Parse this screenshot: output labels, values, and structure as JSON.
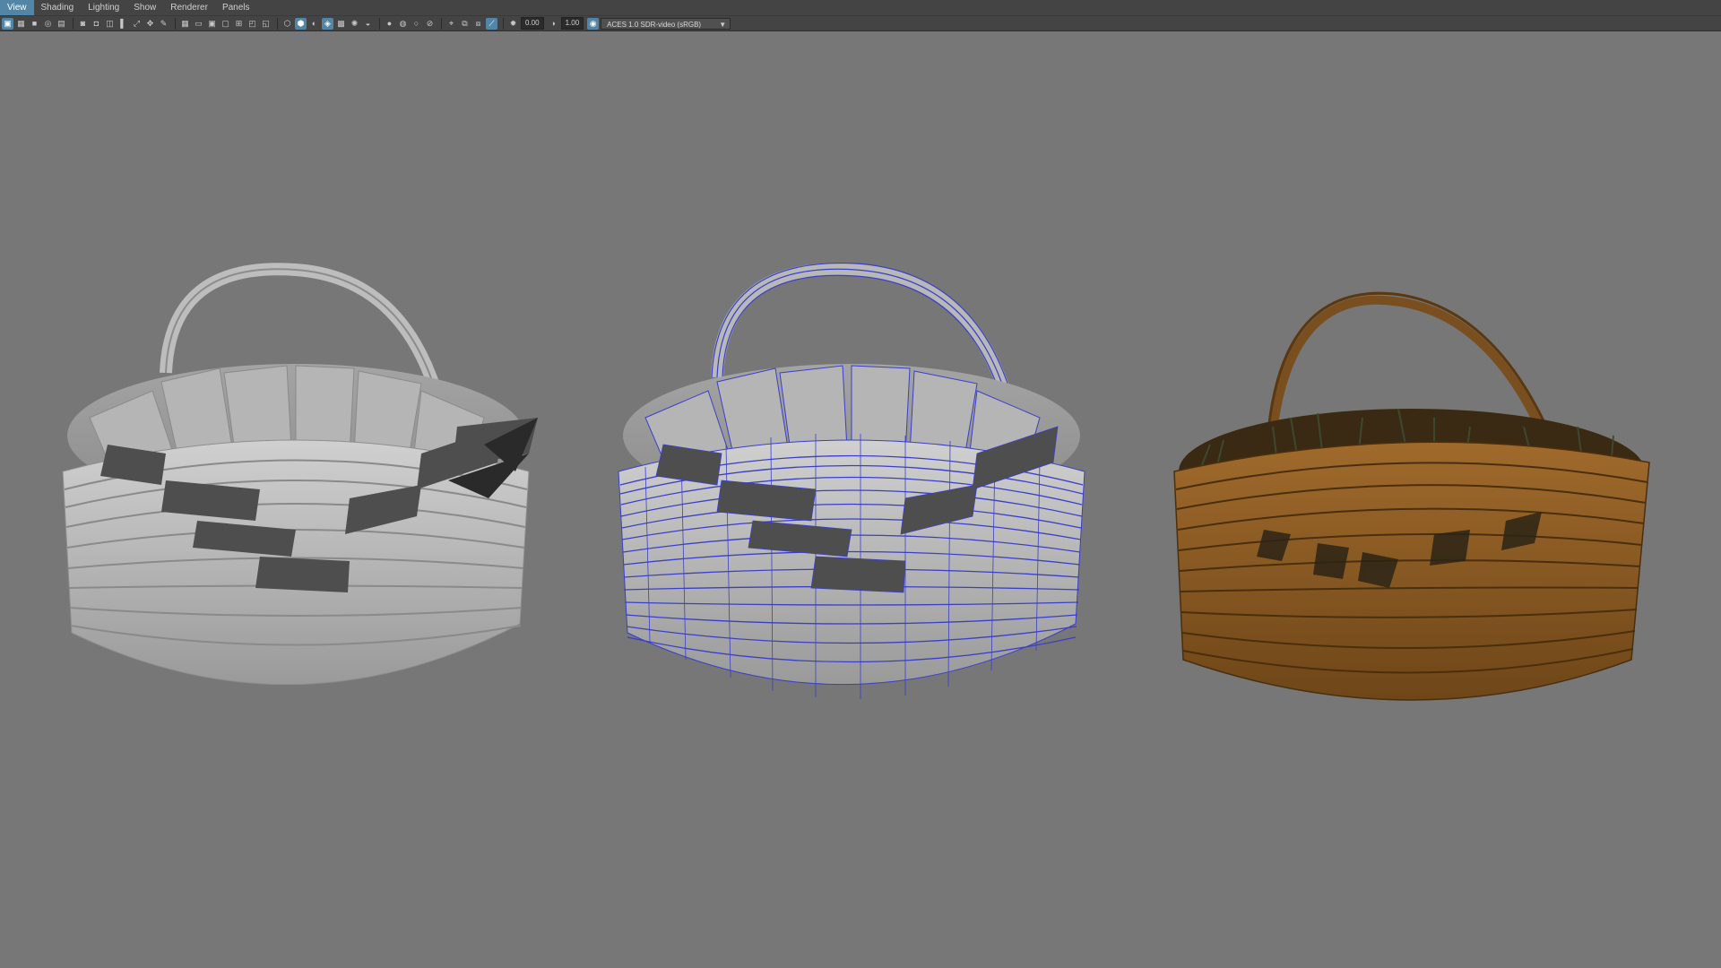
{
  "menu": {
    "view": "View",
    "shading": "Shading",
    "lighting": "Lighting",
    "show": "Show",
    "renderer": "Renderer",
    "panels": "Panels"
  },
  "toolbar": {
    "exposure_value": "0.00",
    "gamma_value": "1.00",
    "color_space": "ACES 1.0 SDR-video (sRGB)"
  },
  "viewport": {
    "background_color": "#777777",
    "models": [
      {
        "name": "basket-smooth-shaded",
        "color": "#b9b9b9"
      },
      {
        "name": "basket-wireframe-on-shaded",
        "color": "#3b3fc8"
      },
      {
        "name": "basket-textured",
        "color": "#8a5a22"
      }
    ]
  }
}
